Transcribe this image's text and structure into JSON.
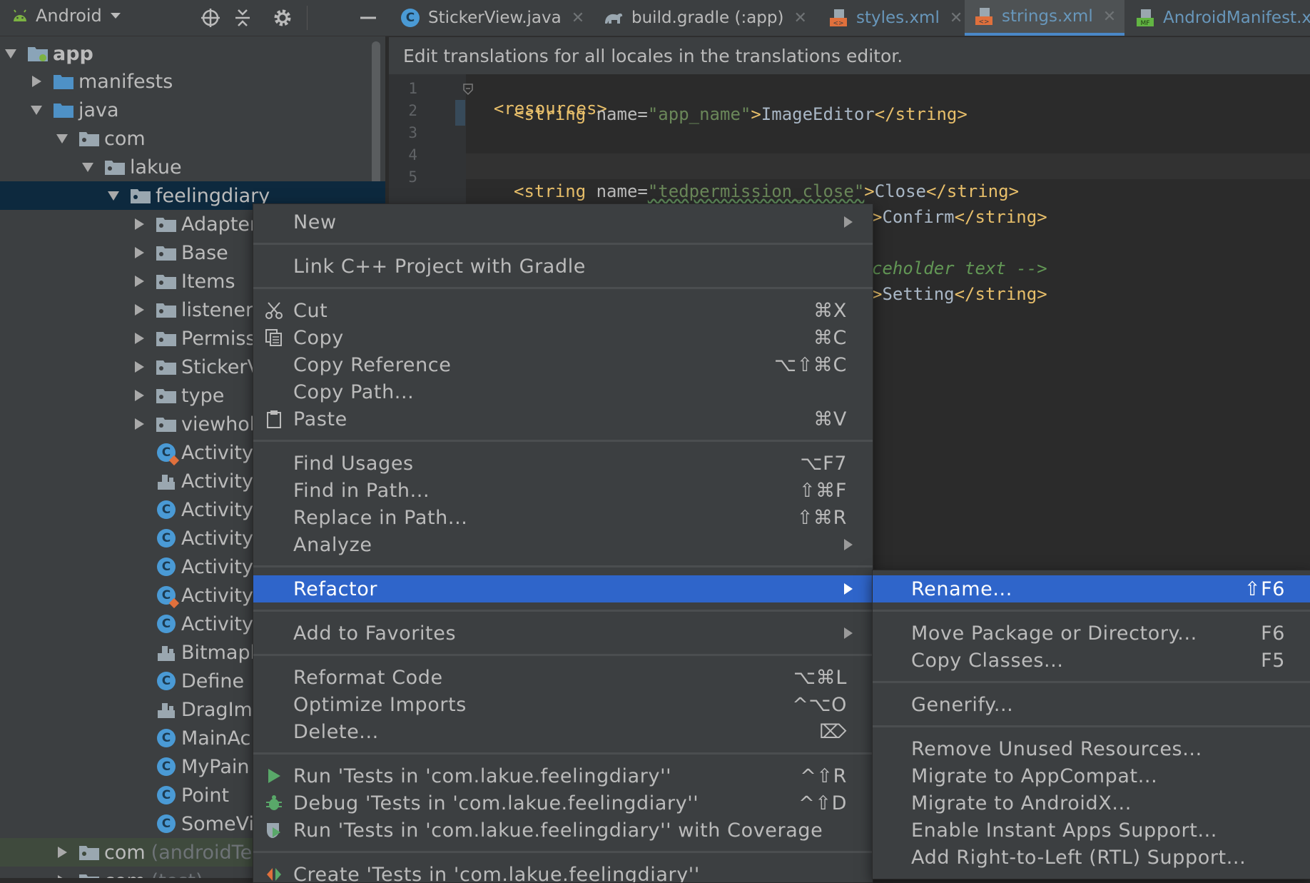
{
  "project_panel": {
    "view_label": "Android",
    "tree": [
      {
        "label": "app",
        "bold": true
      },
      {
        "label": "manifests"
      },
      {
        "label": "java"
      },
      {
        "label": "com"
      },
      {
        "label": "lakue"
      },
      {
        "label": "feelingdiary"
      },
      {
        "label": "Adapter"
      },
      {
        "label": "Base"
      },
      {
        "label": "Items"
      },
      {
        "label": "listener"
      },
      {
        "label": "Permiss"
      },
      {
        "label": "StickerV"
      },
      {
        "label": "type"
      },
      {
        "label": "viewhol"
      },
      {
        "label": "Activity"
      },
      {
        "label": "Activity"
      },
      {
        "label": "Activity"
      },
      {
        "label": "Activity"
      },
      {
        "label": "Activity"
      },
      {
        "label": "Activity"
      },
      {
        "label": "Activity"
      },
      {
        "label": "Bitmapl"
      },
      {
        "label": "Define"
      },
      {
        "label": "DragIma"
      },
      {
        "label": "MainAc"
      },
      {
        "label": "MyPain"
      },
      {
        "label": "Point"
      },
      {
        "label": "SomeVi"
      },
      {
        "label": "com",
        "suffix": "(androidTe"
      },
      {
        "label": "com",
        "suffix": "(test)"
      }
    ]
  },
  "editor_tabs": [
    {
      "label": "StickerView.java",
      "icon": "java-class-icon"
    },
    {
      "label": "build.gradle (:app)",
      "icon": "gradle-icon"
    },
    {
      "label": "styles.xml",
      "icon": "xml-icon"
    },
    {
      "label": "strings.xml",
      "icon": "xml-icon",
      "active": true
    },
    {
      "label": "AndroidManifest.x",
      "icon": "manifest-icon"
    }
  ],
  "editor": {
    "banner": "Edit translations for all locales in the translations editor.",
    "line_numbers": [
      "1",
      "2",
      "3",
      "4",
      "5"
    ],
    "code": {
      "l1_tag": "<resources>",
      "l2_open": "<string ",
      "l2_attr": "name=",
      "l2_val": "\"app_name\"",
      "l2_close": ">",
      "l2_text": "ImageEditor",
      "l2_end": "</string>",
      "l5_open": "<string ",
      "l5_attr": "name=",
      "l5_val": "\"tedpermission_close\"",
      "l5_close": ">",
      "l5_text": "Close",
      "l5_end": "</string>",
      "l6_close": ">",
      "l6_text": "Confirm",
      "l6_end": "</string>",
      "l8_comment": "ceholder text -->",
      "l9_close": ">",
      "l9_text": "Setting",
      "l9_end": "</string>"
    }
  },
  "context_menu": {
    "items": [
      {
        "label": "New",
        "submenu": true
      },
      {
        "label": "Link C++ Project with Gradle"
      },
      {
        "label": "Cut",
        "shortcut": "⌘X",
        "icon": "scissors-icon"
      },
      {
        "label": "Copy",
        "shortcut": "⌘C",
        "icon": "copy-icon"
      },
      {
        "label": "Copy Reference",
        "shortcut": "⌥⇧⌘C"
      },
      {
        "label": "Copy Path...",
        "shortcut": ""
      },
      {
        "label": "Paste",
        "shortcut": "⌘V",
        "icon": "clipboard-icon"
      },
      {
        "label": "Find Usages",
        "shortcut": "⌥F7"
      },
      {
        "label": "Find in Path...",
        "shortcut": "⇧⌘F"
      },
      {
        "label": "Replace in Path...",
        "shortcut": "⇧⌘R"
      },
      {
        "label": "Analyze",
        "submenu": true
      },
      {
        "label": "Refactor",
        "submenu": true,
        "highlighted": true
      },
      {
        "label": "Add to Favorites",
        "submenu": true
      },
      {
        "label": "Reformat Code",
        "shortcut": "⌥⌘L"
      },
      {
        "label": "Optimize Imports",
        "shortcut": "^⌥O"
      },
      {
        "label": "Delete...",
        "shortcut": "⌦"
      },
      {
        "label": "Run 'Tests in 'com.lakue.feelingdiary''",
        "shortcut": "^⇧R",
        "icon": "run-icon"
      },
      {
        "label": "Debug 'Tests in 'com.lakue.feelingdiary''",
        "shortcut": "^⇧D",
        "icon": "debug-icon"
      },
      {
        "label": "Run 'Tests in 'com.lakue.feelingdiary'' with Coverage",
        "icon": "coverage-icon"
      },
      {
        "label": "Create 'Tests in 'com.lakue.feelingdiary''",
        "icon": "create-test-icon"
      }
    ]
  },
  "refactor_submenu": {
    "items": [
      {
        "label": "Rename...",
        "shortcut": "⇧F6",
        "highlighted": true
      },
      {
        "label": "Move Package or Directory...",
        "shortcut": "F6"
      },
      {
        "label": "Copy Classes...",
        "shortcut": "F5"
      },
      {
        "label": "Generify..."
      },
      {
        "label": "Remove Unused Resources..."
      },
      {
        "label": "Migrate to AppCompat..."
      },
      {
        "label": "Migrate to AndroidX..."
      },
      {
        "label": "Enable Instant Apps Support..."
      },
      {
        "label": "Add Right-to-Left (RTL) Support..."
      }
    ]
  },
  "colors": {
    "menu_highlight": "#2f65ca",
    "selection": "#0d293e",
    "tab_underline": "#4a88c7",
    "xml_tag": "#e8bf6a",
    "xml_value": "#6a8759"
  }
}
